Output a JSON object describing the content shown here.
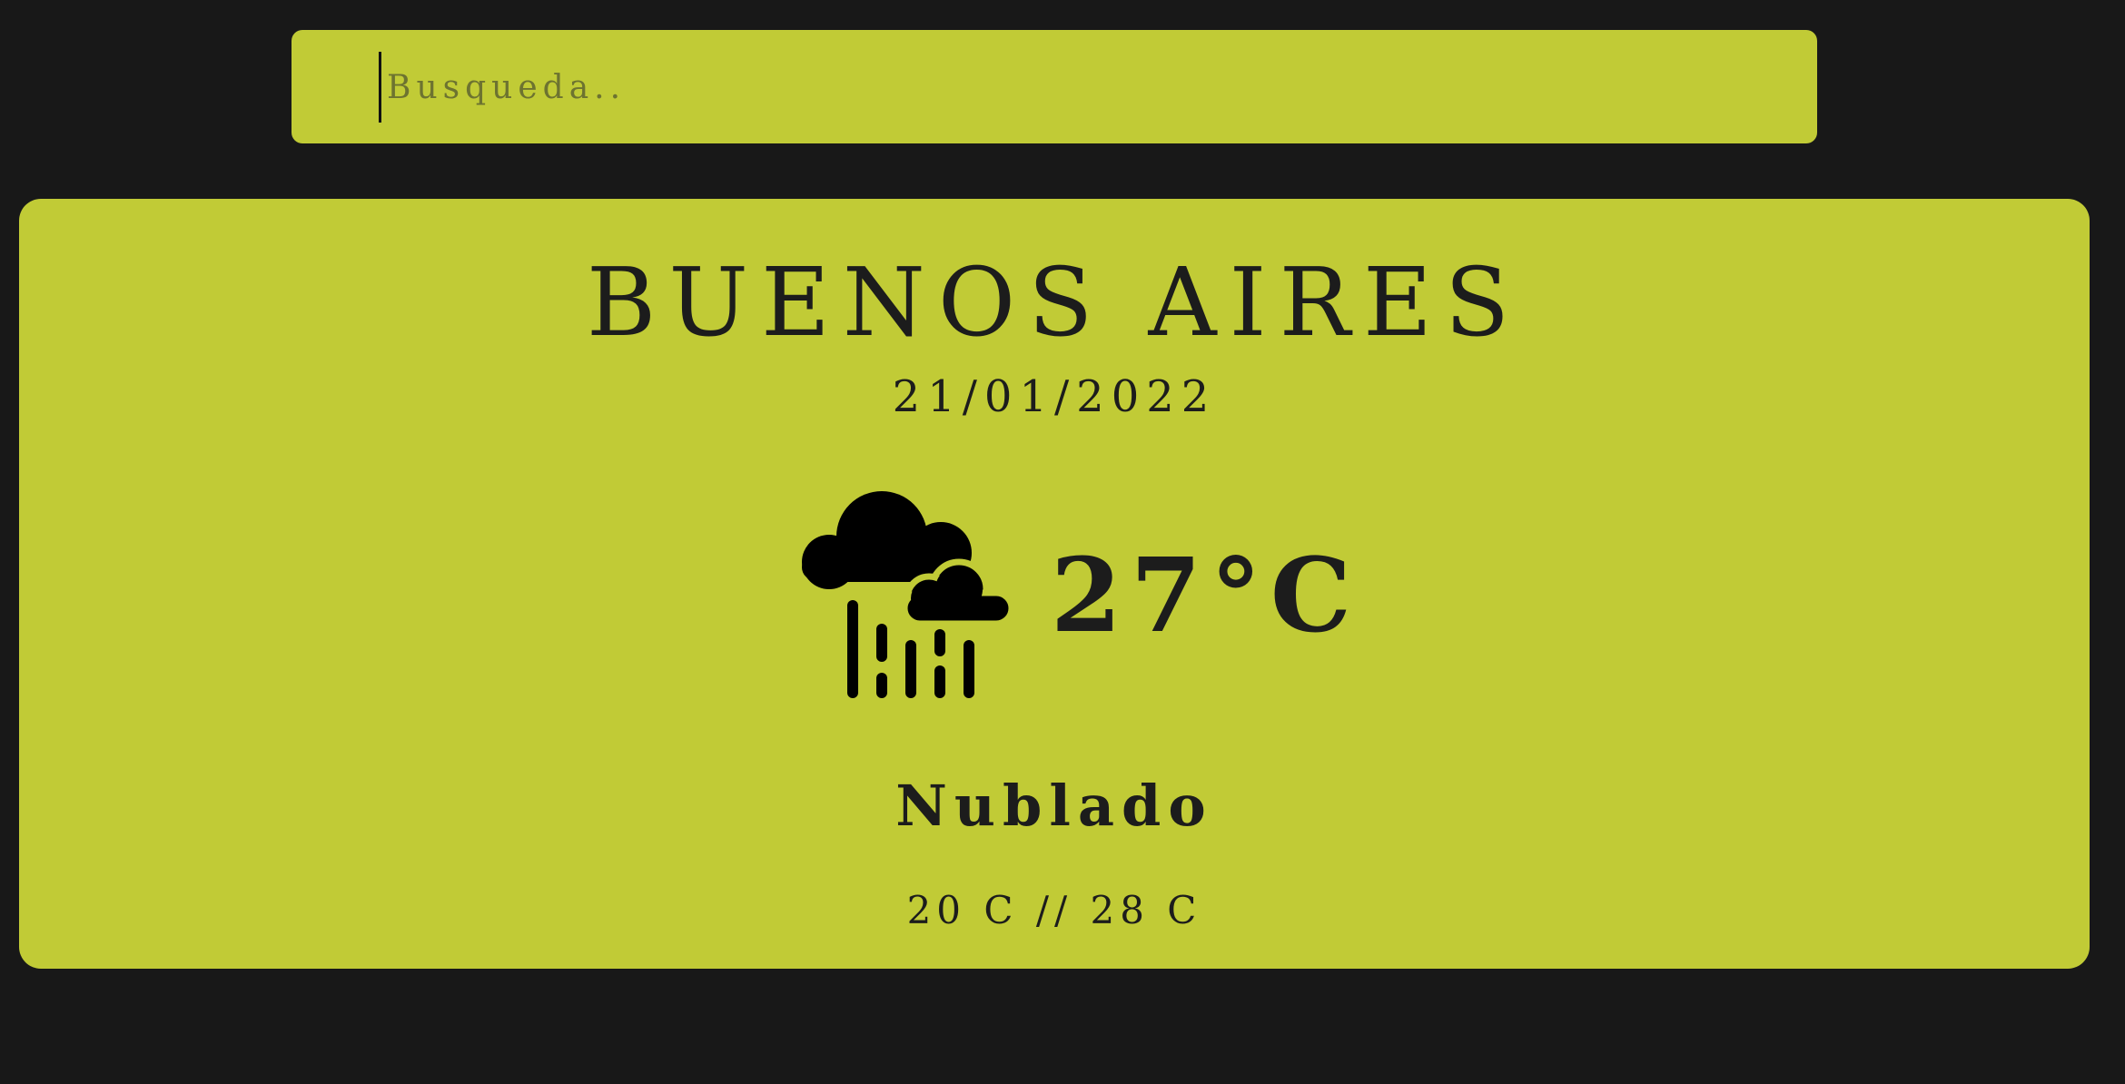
{
  "search": {
    "placeholder": "Busqueda..",
    "value": ""
  },
  "weather": {
    "city": "BUENOS AIRES",
    "date": "21/01/2022",
    "icon": "cloud-rain-icon",
    "temperature": "27°C",
    "condition": "Nublado",
    "range": "20 C // 28 C"
  },
  "colors": {
    "background": "#181818",
    "accent": "#c1cb36",
    "text": "#1c1c1c"
  }
}
